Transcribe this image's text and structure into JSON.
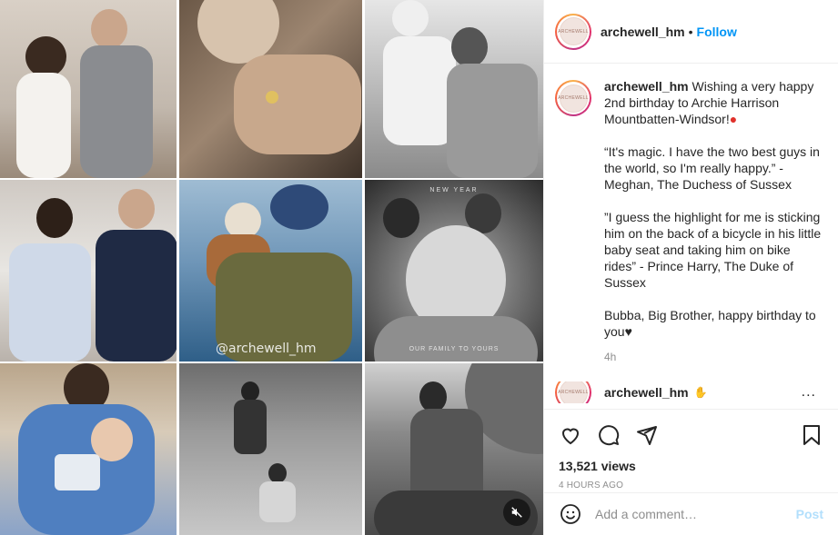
{
  "account": {
    "username": "archewell_hm",
    "separator": "•",
    "follow_label": "Follow",
    "avatar_text": "ARCHEWELL"
  },
  "caption": {
    "username": "archewell_hm",
    "para1": " Wishing a very happy 2nd birthday to Archie Harrison Mountbatten-Windsor!",
    "para2": "“It's magic. I have the two best guys in the world, so I'm really happy.” - Meghan, The Duchess of Sussex",
    "para3": "”I guess the highlight for me is sticking him on the back of a bicycle in his little baby seat and taking him on bike rides” - Prince Harry, The Duke of Sussex",
    "para4": "Bubba, Big Brother, happy birthday to you",
    "time": "4h"
  },
  "next_comment": {
    "username": "archewell_hm",
    "more": "..."
  },
  "stats": {
    "views": "13,521 views",
    "posted": "4 HOURS AGO"
  },
  "comment_box": {
    "placeholder": "Add a comment…",
    "post_label": "Post"
  },
  "media": {
    "watermark": "@archewell_hm",
    "tile6_top": "NEW YEAR",
    "tile6_bottom": "OUR FAMILY TO YOURS"
  },
  "icons": {
    "like": "heart-outline-icon",
    "comment": "comment-bubble-icon",
    "share": "paper-plane-icon",
    "save": "bookmark-icon",
    "emoji": "smiley-icon",
    "mute": "speaker-muted-icon",
    "caption_emoji": "red-balloon-emoji",
    "end_emoji": "black-heart-emoji"
  }
}
